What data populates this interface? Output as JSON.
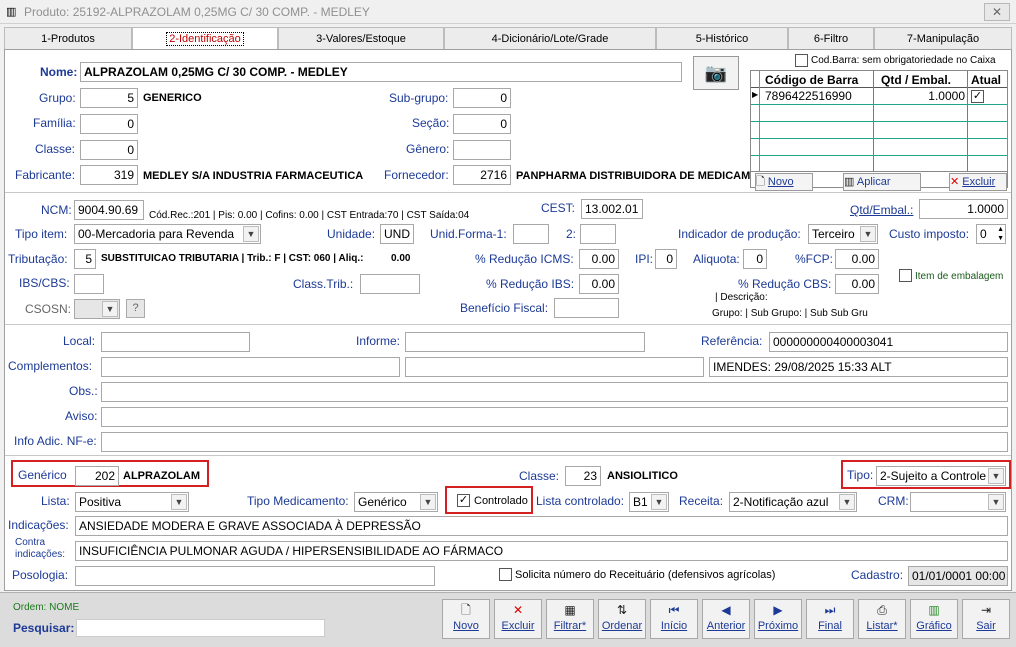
{
  "window": {
    "title": "Produto: 25192-ALPRAZOLAM 0,25MG C/ 30 COMP. - MEDLEY",
    "close": "✕"
  },
  "tabs": [
    "1-Produtos",
    "2-Identificação",
    "3-Valores/Estoque",
    "4-Dicionário/Lote/Grade",
    "5-Histórico",
    "6-Filtro",
    "7-Manipulação"
  ],
  "ident": {
    "nome_label": "Nome:",
    "nome": "ALPRAZOLAM 0,25MG C/ 30 COMP. - MEDLEY",
    "grupo_label": "Grupo:",
    "grupo": "5",
    "grupo_desc": "GENERICO",
    "familia_label": "Família:",
    "familia": "0",
    "classe_label": "Classe:",
    "classe": "0",
    "fabricante_label": "Fabricante:",
    "fabricante": "319",
    "fabricante_desc": "MEDLEY S/A INDUSTRIA FARMACEUTICA",
    "subgrupo_label": "Sub-grupo:",
    "subgrupo": "0",
    "secao_label": "Seção:",
    "secao": "0",
    "genero_label": "Gênero:",
    "genero": "",
    "fornecedor_label": "Fornecedor:",
    "fornecedor": "2716",
    "fornecedor_desc": "PANPHARMA DISTRIBUIDORA DE MEDICAM"
  },
  "barcode": {
    "checkbox_label": "Cod.Barra: sem obrigatoriedade no Caixa",
    "headers": [
      "Código de Barra",
      "Qtd / Embal.",
      "Atual"
    ],
    "row": {
      "codigo": "7896422516990",
      "qtd": "1.0000",
      "atual": "✓"
    },
    "novo": "Novo",
    "aplicar": "Aplicar",
    "excluir": "Excluir"
  },
  "fiscal": {
    "ncm_label": "NCM:",
    "ncm": "9004.90.69",
    "ncm_info": "Cód.Rec.:201 | Pis: 0.00 | Cofins: 0.00 | CST Entrada:70 | CST Saída:04",
    "cest_label": "CEST:",
    "cest": "13.002.01",
    "qtd_label": "Qtd/Embal.:",
    "qtd": "1.0000",
    "tipo_item_label": "Tipo item:",
    "tipo_item": "00-Mercadoria para Revenda",
    "unidade_label": "Unidade:",
    "unidade": "UND",
    "unid_forma_label": "Unid.Forma-1:",
    "unid_forma": "",
    "unid2_label": "2:",
    "unid2": "",
    "ind_prod_label": "Indicador de produção:",
    "ind_prod": "Terceiro",
    "custo_label": "Custo imposto:",
    "custo": "0",
    "trib_label": "Tributação:",
    "trib": "5",
    "trib_desc": "SUBSTITUICAO TRIBUTARIA | Trib.: F | CST: 060 | Aliq.:",
    "trib_aliq": "0.00",
    "red_icms_label": "% Redução ICMS:",
    "red_icms": "0.00",
    "ipi_label": "IPI:",
    "ipi": "0",
    "aliq_label": "Aliquota:",
    "aliq": "0",
    "fcp_label": "%FCP:",
    "fcp": "0.00",
    "ibs_label": "IBS/CBS:",
    "ibs": "",
    "class_trib_label": "Class.Trib.:",
    "class_trib": "",
    "red_ibs_label": "% Redução IBS:",
    "red_ibs": "0.00",
    "red_cbs_label": "% Redução CBS:",
    "red_cbs": "0.00",
    "item_emb_label": "Item de embalagem",
    "csosn_label": "CSOSN:",
    "csosn_q": "?",
    "beneficio_label": "Benefício Fiscal:",
    "beneficio": "",
    "descricao_label": "| Descrição:",
    "grupo_info": "Grupo:  | Sub Grupo:  | Sub Sub Gru"
  },
  "extra": {
    "local_label": "Local:",
    "local": "",
    "informe_label": "Informe:",
    "informe": "",
    "referencia_label": "Referência:",
    "referencia": "000000000400003041",
    "complementos_label": "Complementos:",
    "comp1": "",
    "comp2": "",
    "comp3": "IMENDES: 29/08/2025 15:33 ALT",
    "obs_label": "Obs.:",
    "aviso_label": "Aviso:",
    "info_label": "Info Adic. NF-e:"
  },
  "med": {
    "generico_label": "Genérico",
    "generico": "202",
    "generico_desc": "ALPRAZOLAM",
    "classe_label": "Classe:",
    "classe": "23",
    "classe_desc": "ANSIOLITICO",
    "tipo_label": "Tipo:",
    "tipo": "2-Sujeito a Controle",
    "lista_label": "Lista:",
    "lista": "Positiva",
    "tipo_med_label": "Tipo Medicamento:",
    "tipo_med": "Genérico",
    "controlado_label": "Controlado",
    "lista_ctrl_label": "Lista controlado:",
    "lista_ctrl": "B1",
    "receita_label": "Receita:",
    "receita": "2-Notificação azul",
    "crm_label": "CRM:",
    "crm": "",
    "indicacoes_label": "Indicações:",
    "indicacoes": "ANSIEDADE MODERA E GRAVE ASSOCIADA À DEPRESSÃO",
    "contra_label1": "Contra",
    "contra_label2": "indicações:",
    "contra": "INSUFICIÊNCIA PULMONAR AGUDA / HIPERSENSIBILIDADE AO FÁRMACO",
    "posologia_label": "Posologia:",
    "solicita_label": "Solicita número do Receituário (defensivos agrícolas)",
    "cadastro_label": "Cadastro:",
    "cadastro": "01/01/0001 00:00"
  },
  "bottom": {
    "ordem": "Ordem: NOME",
    "pesquisar_label": "Pesquisar:",
    "buttons": [
      {
        "label": "Novo",
        "icon": "🗋"
      },
      {
        "label": "Excluir",
        "icon": "✕"
      },
      {
        "label": "Filtrar*",
        "icon": "▦"
      },
      {
        "label": "Ordenar",
        "icon": "⇅"
      },
      {
        "label": "Início",
        "icon": "⏮"
      },
      {
        "label": "Anterior",
        "icon": "◀"
      },
      {
        "label": "Próximo",
        "icon": "▶"
      },
      {
        "label": "Final",
        "icon": "⏭"
      },
      {
        "label": "Listar*",
        "icon": "⎙"
      },
      {
        "label": "Gráfico",
        "icon": "▥"
      },
      {
        "label": "Sair",
        "icon": "⇥"
      }
    ]
  }
}
